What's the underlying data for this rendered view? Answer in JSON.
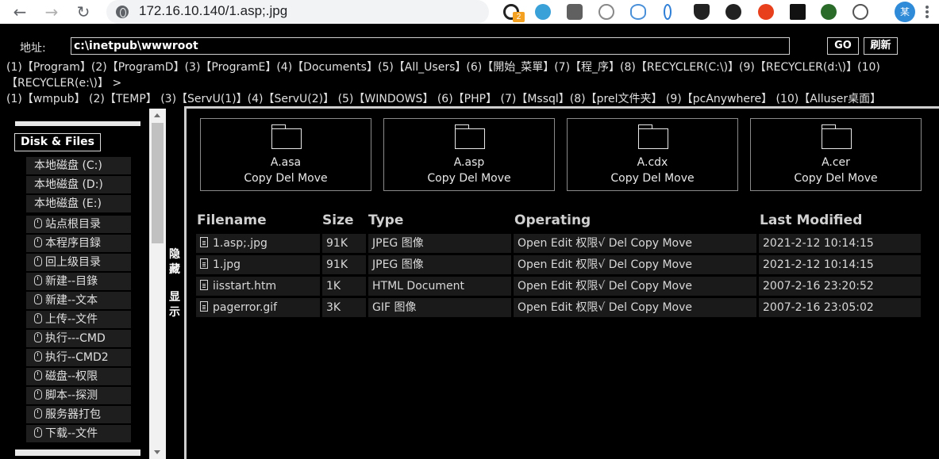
{
  "browser": {
    "url": "172.16.10.140/1.asp;.jpg",
    "ext_badge": "2",
    "profile_label": "某",
    "icons": [
      "back-icon",
      "forward-icon",
      "reload-icon",
      "globe-icon"
    ]
  },
  "address": {
    "label": "地址:",
    "value": "c:\\inetpub\\wwwroot",
    "go_label": "GO",
    "refresh_label": "刷新"
  },
  "path_lines": [
    "(1)【Program】(2)【ProgramD】(3)【ProgramE】(4)【Documents】(5)【All_Users】(6)【開始_菜單】(7)【程_序】(8)【RECYCLER(C:\\)】(9)【RECYCLER(d:\\)】(10)",
    "【RECYCLER(e:\\)】 >",
    "(1)【wmpub】 (2)【TEMP】     (3)【ServU(1)】(4)【ServU(2)】 (5)【WINDOWS】  (6)【PHP】      (7)【Mssql】(8)【prel文件夹】   (9)【pcAnywhere】 (10)【Alluser桌面】"
  ],
  "sidebar": {
    "title": "Disk & Files",
    "disks": [
      "本地磁盘 (C:)",
      "本地磁盘 (D:)",
      "本地磁盘 (E:)"
    ],
    "items": [
      "站点根目录",
      "本程序目録",
      "回上级目录",
      "新建--目錄",
      "新建--文本",
      "上传--文件",
      "执行---CMD",
      "执行--CMD2",
      "磁盘--权限",
      "脚本--探测",
      "服务器打包",
      "下载--文件"
    ]
  },
  "toggle": {
    "hide": [
      "隐",
      "藏"
    ],
    "show": [
      "显",
      "示"
    ]
  },
  "folders": [
    {
      "name": "A.asa",
      "ops": "Copy Del Move"
    },
    {
      "name": "A.asp",
      "ops": "Copy Del Move"
    },
    {
      "name": "A.cdx",
      "ops": "Copy Del Move"
    },
    {
      "name": "A.cer",
      "ops": "Copy Del Move"
    }
  ],
  "table": {
    "headers": [
      "Filename",
      "Size",
      "Type",
      "Operating",
      "Last Modified"
    ],
    "rows": [
      {
        "filename": "1.asp;.jpg",
        "size": "91K",
        "type": "JPEG 图像",
        "ops": "Open Edit 权限√ Del Copy Move",
        "modified": "2021-2-12 10:14:15"
      },
      {
        "filename": "1.jpg",
        "size": "91K",
        "type": "JPEG 图像",
        "ops": "Open Edit 权限√ Del Copy Move",
        "modified": "2021-2-12 10:14:15"
      },
      {
        "filename": "iisstart.htm",
        "size": "1K",
        "type": "HTML Document",
        "ops": "Open Edit 权限√ Del Copy Move",
        "modified": "2007-2-16 23:20:52"
      },
      {
        "filename": "pagerror.gif",
        "size": "3K",
        "type": "GIF 图像",
        "ops": "Open Edit 权限√ Del Copy Move",
        "modified": "2007-2-16 23:05:02"
      }
    ]
  }
}
